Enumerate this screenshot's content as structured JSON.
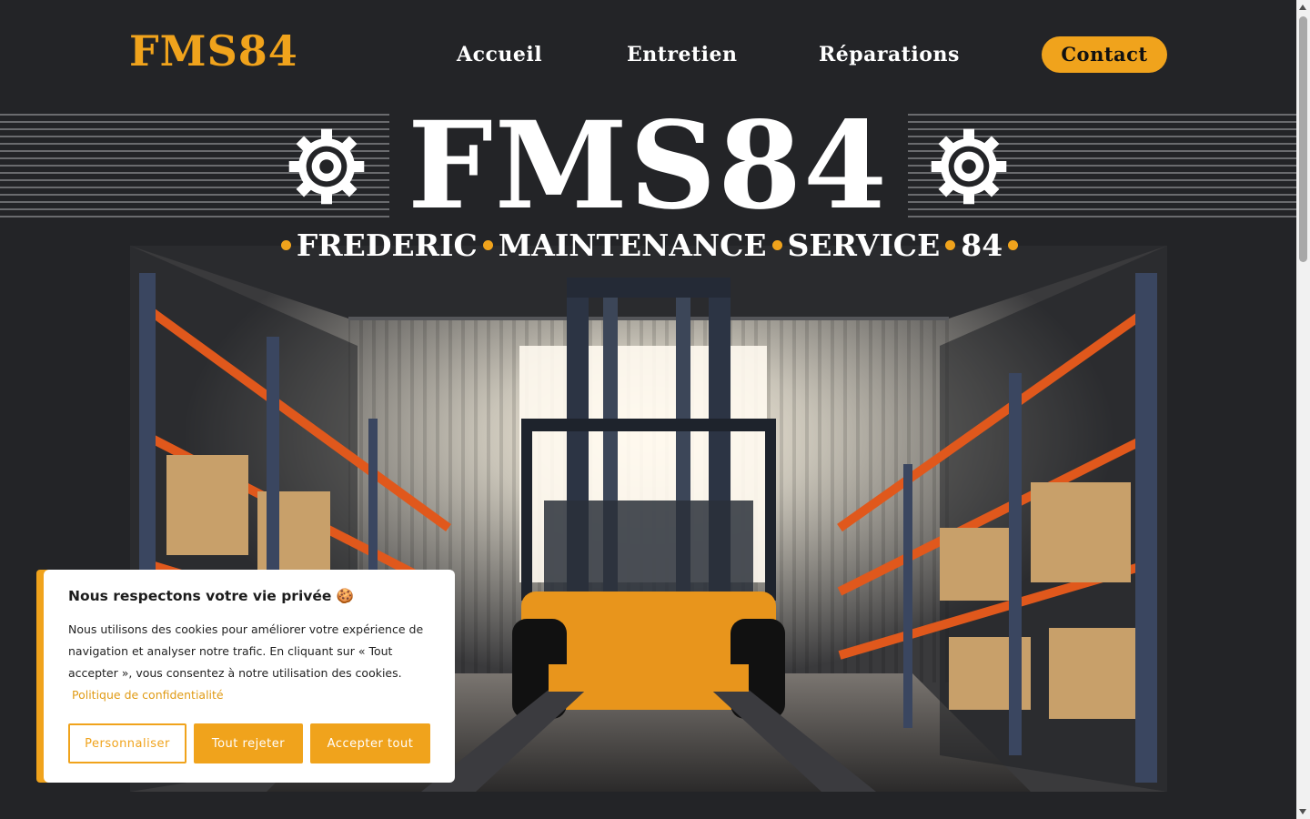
{
  "header": {
    "logo": "FMS84",
    "nav": [
      "Accueil",
      "Entretien",
      "Réparations"
    ],
    "contact_label": "Contact"
  },
  "hero": {
    "title": "FMS84",
    "subtitle_words": [
      "FREDERIC",
      "MAINTENANCE",
      "SERVICE",
      "84"
    ],
    "image_alt": "Forklift in warehouse"
  },
  "cookie": {
    "title": "Nous respectons votre vie privée 🍪",
    "text": "Nous utilisons des cookies pour améliorer votre expérience de navigation et analyser notre trafic. En cliquant sur « Tout accepter », vous consentez à notre utilisation des cookies.",
    "policy_link": "Politique de confidentialité",
    "btn_customize": "Personnaliser",
    "btn_reject": "Tout rejeter",
    "btn_accept": "Accepter tout"
  },
  "colors": {
    "accent": "#f0a31c",
    "background": "#232427",
    "text": "#ffffff"
  }
}
